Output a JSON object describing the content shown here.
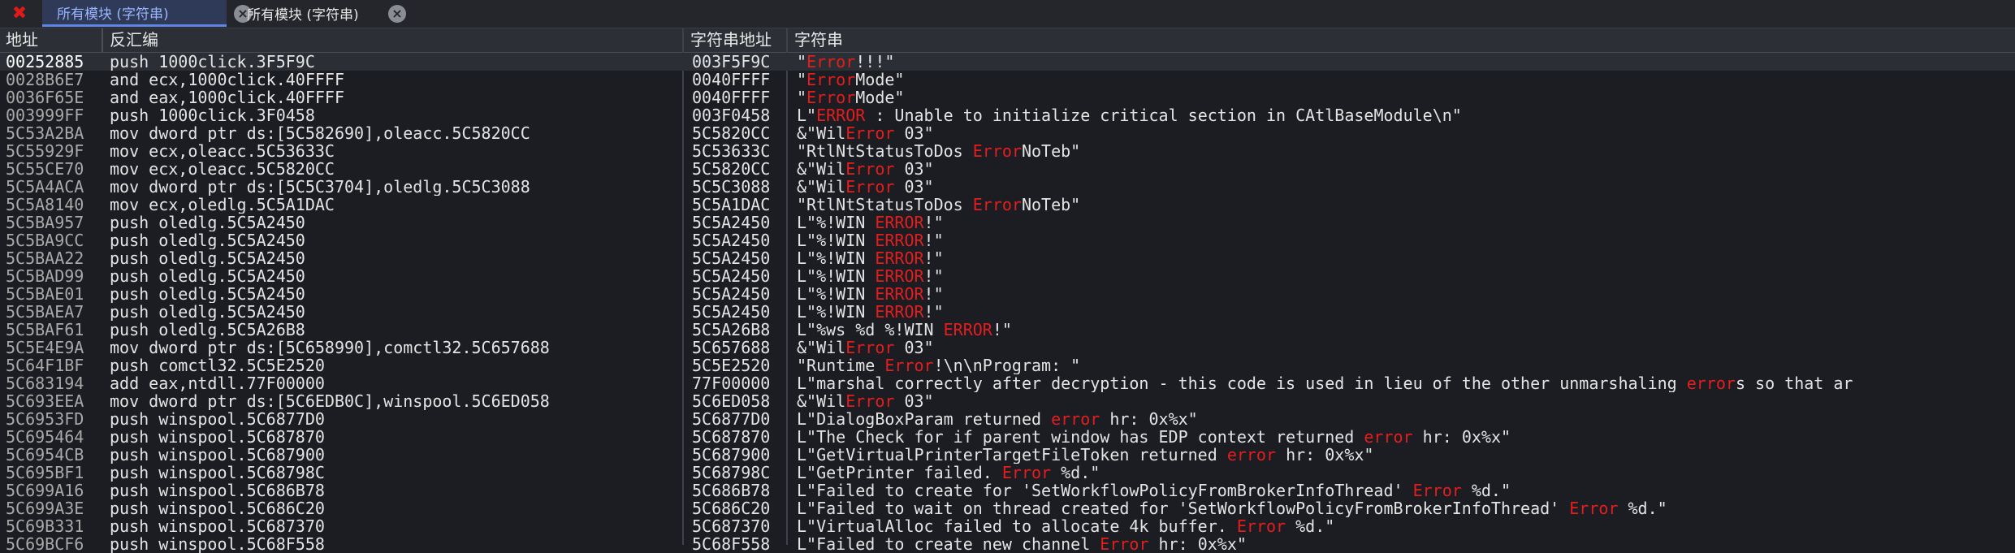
{
  "window": {
    "close_glyph": "✖"
  },
  "tabs": [
    {
      "label": "所有模块 (字符串)",
      "active": true
    },
    {
      "label": "所有模块 (字符串)",
      "active": false
    }
  ],
  "columns": {
    "address": "地址",
    "disassembly": "反汇编",
    "string_address": "字符串地址",
    "string": "字符串"
  },
  "rows": [
    {
      "addr": "00252885",
      "dis": "push 1000click.3F5F9C",
      "saddr": "003F5F9C",
      "str": [
        "\"",
        "Error",
        "!!!\""
      ]
    },
    {
      "addr": "0028B6E7",
      "dis": "and ecx,1000click.40FFFF",
      "saddr": "0040FFFF",
      "str": [
        "\"",
        "Error",
        "Mode\""
      ]
    },
    {
      "addr": "0036F65E",
      "dis": "and eax,1000click.40FFFF",
      "saddr": "0040FFFF",
      "str": [
        "\"",
        "Error",
        "Mode\""
      ]
    },
    {
      "addr": "003999FF",
      "dis": "push 1000click.3F0458",
      "saddr": "003F0458",
      "str": [
        "L\"",
        "ERROR",
        " : Unable to initialize critical section in CAtlBaseModule\\n\""
      ]
    },
    {
      "addr": "5C53A2BA",
      "dis": "mov dword ptr ds:[5C582690],oleacc.5C5820CC",
      "saddr": "5C5820CC",
      "str": [
        "&\"Wil",
        "Error",
        "_03\""
      ]
    },
    {
      "addr": "5C55929F",
      "dis": "mov ecx,oleacc.5C53633C",
      "saddr": "5C53633C",
      "str": [
        "\"RtlNtStatusToDos ",
        "Error",
        "NoTeb\""
      ]
    },
    {
      "addr": "5C55CE70",
      "dis": "mov ecx,oleacc.5C5820CC",
      "saddr": "5C5820CC",
      "str": [
        "&\"Wil",
        "Error",
        "_03\""
      ]
    },
    {
      "addr": "5C5A4ACA",
      "dis": "mov dword ptr ds:[5C5C3704],oledlg.5C5C3088",
      "saddr": "5C5C3088",
      "str": [
        "&\"Wil",
        "Error",
        "_03\""
      ]
    },
    {
      "addr": "5C5A8140",
      "dis": "mov ecx,oledlg.5C5A1DAC",
      "saddr": "5C5A1DAC",
      "str": [
        "\"RtlNtStatusToDos ",
        "Error",
        "NoTeb\""
      ]
    },
    {
      "addr": "5C5BA957",
      "dis": "push oledlg.5C5A2450",
      "saddr": "5C5A2450",
      "str": [
        "L\"%!WIN ",
        "ERROR",
        "!\""
      ]
    },
    {
      "addr": "5C5BA9CC",
      "dis": "push oledlg.5C5A2450",
      "saddr": "5C5A2450",
      "str": [
        "L\"%!WIN ",
        "ERROR",
        "!\""
      ]
    },
    {
      "addr": "5C5BAA22",
      "dis": "push oledlg.5C5A2450",
      "saddr": "5C5A2450",
      "str": [
        "L\"%!WIN ",
        "ERROR",
        "!\""
      ]
    },
    {
      "addr": "5C5BAD99",
      "dis": "push oledlg.5C5A2450",
      "saddr": "5C5A2450",
      "str": [
        "L\"%!WIN ",
        "ERROR",
        "!\""
      ]
    },
    {
      "addr": "5C5BAE01",
      "dis": "push oledlg.5C5A2450",
      "saddr": "5C5A2450",
      "str": [
        "L\"%!WIN ",
        "ERROR",
        "!\""
      ]
    },
    {
      "addr": "5C5BAEA7",
      "dis": "push oledlg.5C5A2450",
      "saddr": "5C5A2450",
      "str": [
        "L\"%!WIN ",
        "ERROR",
        "!\""
      ]
    },
    {
      "addr": "5C5BAF61",
      "dis": "push oledlg.5C5A26B8",
      "saddr": "5C5A26B8",
      "str": [
        "L\"%ws %d %!WIN ",
        "ERROR",
        "!\""
      ]
    },
    {
      "addr": "5C5E4E9A",
      "dis": "mov dword ptr ds:[5C658990],comctl32.5C657688",
      "saddr": "5C657688",
      "str": [
        "&\"Wil",
        "Error",
        "_03\""
      ]
    },
    {
      "addr": "5C64F1BF",
      "dis": "push comctl32.5C5E2520",
      "saddr": "5C5E2520",
      "str": [
        "\"Runtime ",
        "Error",
        "!\\n\\nProgram: \""
      ]
    },
    {
      "addr": "5C683194",
      "dis": "add eax,ntdll.77F00000",
      "saddr": "77F00000",
      "str": [
        "L\"marshal correctly after decryption - this code is used in lieu of the other unmarshaling ",
        "error",
        "s so that ar"
      ]
    },
    {
      "addr": "5C693EEA",
      "dis": "mov dword ptr ds:[5C6EDB0C],winspool.5C6ED058",
      "saddr": "5C6ED058",
      "str": [
        "&\"Wil",
        "Error",
        "_03\""
      ]
    },
    {
      "addr": "5C6953FD",
      "dis": "push winspool.5C6877D0",
      "saddr": "5C6877D0",
      "str": [
        "L\"DialogBoxParam returned ",
        "error",
        " hr: 0x%x\""
      ]
    },
    {
      "addr": "5C695464",
      "dis": "push winspool.5C687870",
      "saddr": "5C687870",
      "str": [
        "L\"The Check for if parent window has EDP context returned ",
        "error",
        " hr: 0x%x\""
      ]
    },
    {
      "addr": "5C6954CB",
      "dis": "push winspool.5C687900",
      "saddr": "5C687900",
      "str": [
        "L\"GetVirtualPrinterTargetFileToken returned ",
        "error",
        " hr: 0x%x\""
      ]
    },
    {
      "addr": "5C695BF1",
      "dis": "push winspool.5C68798C",
      "saddr": "5C68798C",
      "str": [
        "L\"GetPrinter failed. ",
        "Error",
        " %d.\""
      ]
    },
    {
      "addr": "5C699A16",
      "dis": "push winspool.5C686B78",
      "saddr": "5C686B78",
      "str": [
        "L\"Failed to create for 'SetWorkflowPolicyFromBrokerInfoThread' ",
        "Error",
        " %d.\""
      ]
    },
    {
      "addr": "5C699A3E",
      "dis": "push winspool.5C686C20",
      "saddr": "5C686C20",
      "str": [
        "L\"Failed to wait on thread created for 'SetWorkflowPolicyFromBrokerInfoThread' ",
        "Error",
        " %d.\""
      ]
    },
    {
      "addr": "5C69B331",
      "dis": "push winspool.5C687370",
      "saddr": "5C687370",
      "str": [
        "L\"VirtualAlloc failed to allocate 4k buffer. ",
        "Error",
        " %d.\""
      ]
    },
    {
      "addr": "5C69BCF6",
      "dis": "push winspool.5C68F558",
      "saddr": "5C68F558",
      "str": [
        "L\"Failed to create new channel ",
        "Error",
        " hr: 0x%x\""
      ]
    }
  ]
}
